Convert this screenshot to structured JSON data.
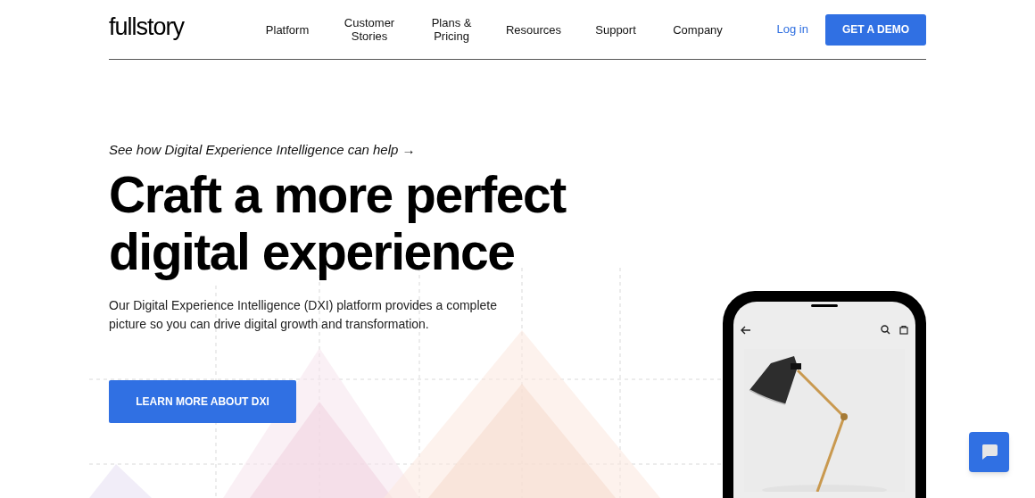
{
  "header": {
    "logo": "fullstory",
    "nav": [
      {
        "label": "Platform"
      },
      {
        "label": "Customer Stories"
      },
      {
        "label": "Plans & Pricing"
      },
      {
        "label": "Resources"
      },
      {
        "label": "Support"
      },
      {
        "label": "Company"
      }
    ],
    "login": "Log in",
    "demo_button": "GET A DEMO"
  },
  "hero": {
    "eyebrow": "See how Digital Experience Intelligence can help →",
    "headline": "Craft a more perfect digital experience",
    "body": "Our Digital Experience Intelligence (DXI) platform provides a complete picture so you can drive digital growth and transformation.",
    "button": "LEARN MORE ABOUT DXI"
  }
}
